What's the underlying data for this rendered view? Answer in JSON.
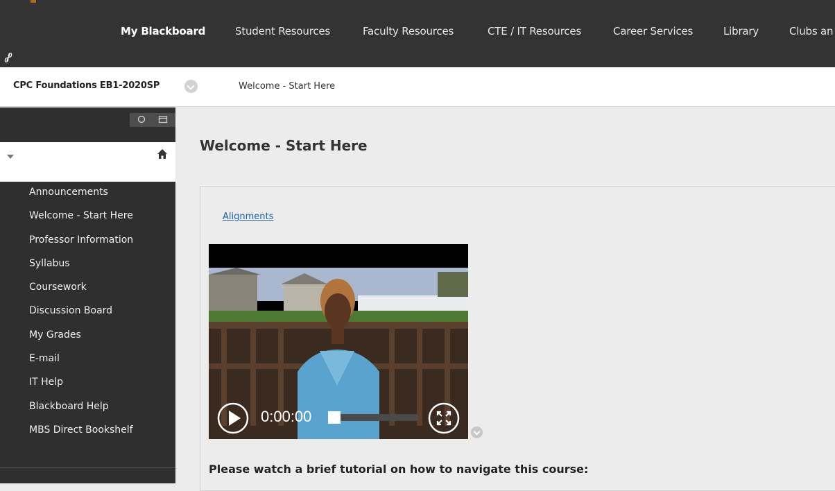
{
  "nav": {
    "tabs": [
      {
        "label": "My Blackboard",
        "active": true
      },
      {
        "label": "Student Resources"
      },
      {
        "label": "Faculty Resources"
      },
      {
        "label": "CTE / IT Resources"
      },
      {
        "label": "Career Services"
      },
      {
        "label": "Library"
      },
      {
        "label": "Clubs an"
      }
    ],
    "link_icon": "link-icon"
  },
  "breadcrumb": {
    "course_title": "CPC Foundations EB1-2020SP",
    "current_page": "Welcome - Start Here"
  },
  "sidebar": {
    "tools": [
      "refresh-icon",
      "folder-icon"
    ],
    "items": [
      {
        "label": "Announcements"
      },
      {
        "label": "Welcome - Start Here"
      },
      {
        "label": "Professor Information"
      },
      {
        "label": "Syllabus"
      },
      {
        "label": "Coursework"
      },
      {
        "label": "Discussion Board"
      },
      {
        "label": "My Grades"
      },
      {
        "label": "E-mail"
      },
      {
        "label": "IT Help"
      },
      {
        "label": "Blackboard Help"
      },
      {
        "label": "MBS Direct Bookshelf"
      }
    ]
  },
  "main": {
    "title": "Welcome - Start Here",
    "alignments_link": "Alignments",
    "video": {
      "time": "0:00:00",
      "progress": 0.14
    },
    "tutorial_heading": "Please watch a brief tutorial on how to navigate this course:"
  },
  "colors": {
    "topbar": "#333333",
    "sidebar": "#2f2f2f",
    "link": "#1e5fa0"
  }
}
